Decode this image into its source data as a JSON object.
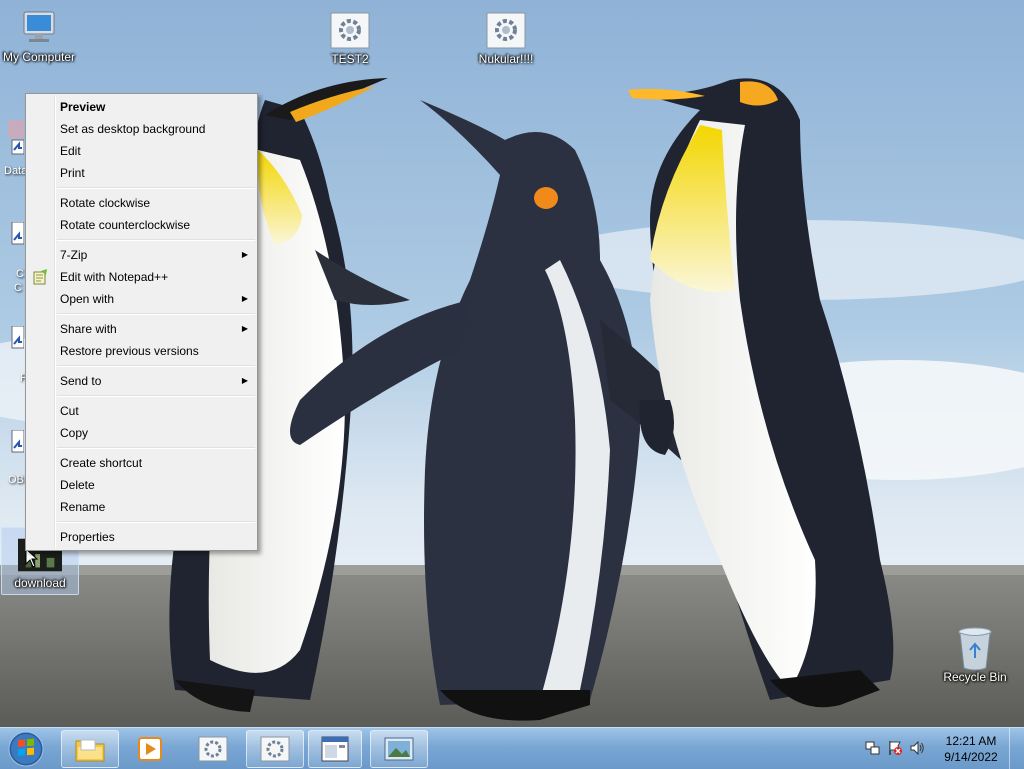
{
  "desktop": {
    "icons": {
      "my_computer": "My Computer",
      "test2": "TEST2",
      "nukular": "Nukular!!!!",
      "recycle_bin": "Recycle Bin",
      "download": "download",
      "partial_data": "Data",
      "partial_c": "C",
      "partial_c2": "C",
      "partial_f": "F",
      "partial_ob": "OB"
    }
  },
  "context_menu": {
    "items": [
      {
        "label": "Preview"
      },
      {
        "label": "Set as desktop background"
      },
      {
        "label": "Edit"
      },
      {
        "label": "Print"
      },
      {
        "label": "Rotate clockwise"
      },
      {
        "label": "Rotate counterclockwise"
      },
      {
        "label": "7-Zip"
      },
      {
        "label": "Edit with Notepad++"
      },
      {
        "label": "Open with"
      },
      {
        "label": "Share with"
      },
      {
        "label": "Restore previous versions"
      },
      {
        "label": "Send to"
      },
      {
        "label": "Cut"
      },
      {
        "label": "Copy"
      },
      {
        "label": "Create shortcut"
      },
      {
        "label": "Delete"
      },
      {
        "label": "Rename"
      },
      {
        "label": "Properties"
      }
    ],
    "submenu_arrow": "▶"
  },
  "taskbar": {
    "clock_time": "12:21 AM",
    "clock_date": "9/14/2022",
    "pinned_icons": [
      "start-orb-icon",
      "folder-icon",
      "media-player-icon",
      "app-gear-icon",
      "app-gear-icon",
      "window-icon",
      "photo-viewer-icon"
    ],
    "tray_icons": [
      "network-icon",
      "action-center-flag-icon",
      "volume-icon"
    ]
  }
}
